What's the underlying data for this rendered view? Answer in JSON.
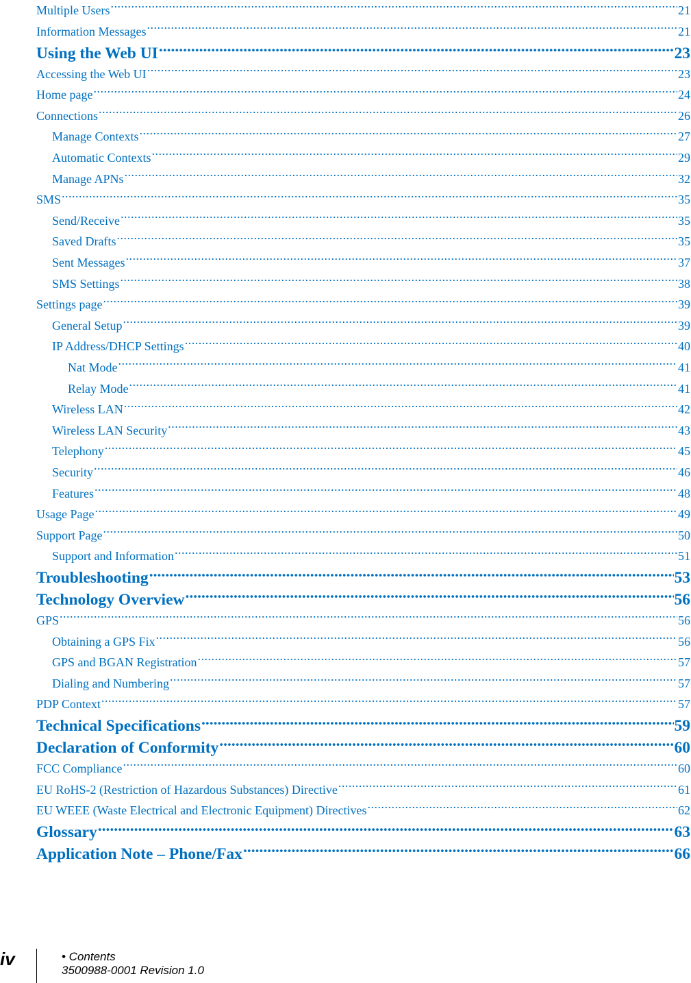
{
  "toc": [
    {
      "title": "Multiple Users",
      "page": "21",
      "level": 1
    },
    {
      "title": "Information Messages",
      "page": "21",
      "level": 1
    },
    {
      "title": "Using the Web UI",
      "page": "23",
      "level": 0
    },
    {
      "title": "Accessing the Web UI",
      "page": "23",
      "level": 1
    },
    {
      "title": "Home page",
      "page": "24",
      "level": 1
    },
    {
      "title": "Connections",
      "page": "26",
      "level": 1
    },
    {
      "title": "Manage Contexts",
      "page": "27",
      "level": 2
    },
    {
      "title": "Automatic Contexts",
      "page": "29",
      "level": 2
    },
    {
      "title": "Manage APNs",
      "page": "32",
      "level": 2
    },
    {
      "title": "SMS",
      "page": "35",
      "level": 1
    },
    {
      "title": "Send/Receive",
      "page": "35",
      "level": 2
    },
    {
      "title": "Saved Drafts",
      "page": "35",
      "level": 2
    },
    {
      "title": "Sent Messages",
      "page": "37",
      "level": 2
    },
    {
      "title": "SMS Settings",
      "page": "38",
      "level": 2
    },
    {
      "title": "Settings page",
      "page": "39",
      "level": 1
    },
    {
      "title": "General Setup",
      "page": "39",
      "level": 2
    },
    {
      "title": "IP Address/DHCP Settings",
      "page": "40",
      "level": 2
    },
    {
      "title": "Nat Mode",
      "page": "41",
      "level": 3
    },
    {
      "title": "Relay Mode",
      "page": "41",
      "level": 3
    },
    {
      "title": "Wireless LAN",
      "page": "42",
      "level": 2
    },
    {
      "title": "Wireless LAN Security",
      "page": "43",
      "level": 2
    },
    {
      "title": "Telephony",
      "page": "45",
      "level": 2
    },
    {
      "title": "Security",
      "page": "46",
      "level": 2
    },
    {
      "title": "Features",
      "page": "48",
      "level": 2
    },
    {
      "title": "Usage Page",
      "page": "49",
      "level": 1
    },
    {
      "title": "Support Page",
      "page": "50",
      "level": 1
    },
    {
      "title": "Support and Information",
      "page": "51",
      "level": 2
    },
    {
      "title": "Troubleshooting",
      "page": "53",
      "level": 0
    },
    {
      "title": "Technology Overview",
      "page": "56",
      "level": 0
    },
    {
      "title": "GPS",
      "page": "56",
      "level": 1
    },
    {
      "title": "Obtaining a GPS Fix",
      "page": "56",
      "level": 2
    },
    {
      "title": "GPS and BGAN Registration",
      "page": "57",
      "level": 2
    },
    {
      "title": "Dialing and Numbering",
      "page": "57",
      "level": 2
    },
    {
      "title": "PDP Context",
      "page": "57",
      "level": 1
    },
    {
      "title": "Technical Specifications",
      "page": "59",
      "level": 0
    },
    {
      "title": "Declaration of Conformity",
      "page": "60",
      "level": 0
    },
    {
      "title": "FCC Compliance",
      "page": "60",
      "level": 1
    },
    {
      "title": "EU RoHS-2 (Restriction of Hazardous Substances) Directive",
      "page": "61",
      "level": 1
    },
    {
      "title": "EU WEEE (Waste Electrical and Electronic Equipment) Directives",
      "page": "62",
      "level": 1
    },
    {
      "title": "Glossary",
      "page": "63",
      "level": 0
    },
    {
      "title": "Application Note – Phone/Fax",
      "page": "66",
      "level": 0
    }
  ],
  "footer": {
    "page_number": "iv",
    "section": "• Contents",
    "doc_id": "3500988-0001  Revision 1.0"
  },
  "colors": {
    "link": "#0070c0",
    "footer_text": "#000000"
  }
}
